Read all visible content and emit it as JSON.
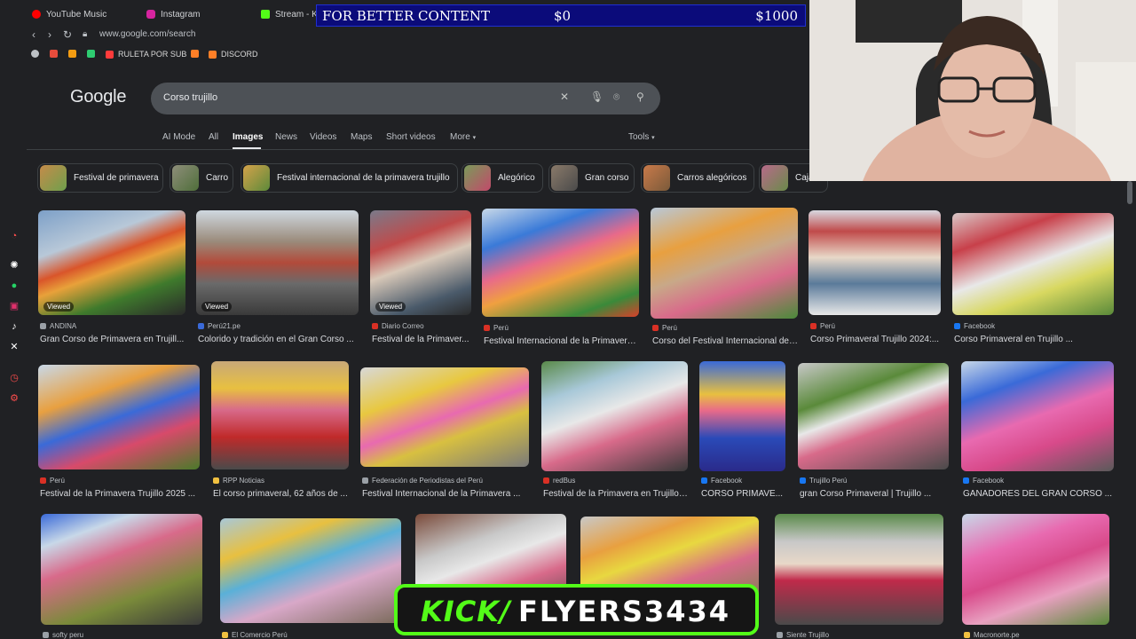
{
  "tabs": [
    {
      "label": "YouTube Music",
      "color": "#ff0000"
    },
    {
      "label": "Instagram",
      "color": "#d6249f"
    },
    {
      "label": "Stream - Kick",
      "color": "#53fc18"
    }
  ],
  "address": {
    "url": "www.google.com/search"
  },
  "bookmarks": [
    {
      "label": "",
      "color": "#bdc1c6"
    },
    {
      "label": "",
      "color": "#e74c3c"
    },
    {
      "label": "",
      "color": "#f39c12"
    },
    {
      "label": "",
      "color": "#2ecc71"
    },
    {
      "label": "RULETA POR SUB",
      "color": "#ff3b3b"
    },
    {
      "label": "",
      "color": "#ff7f27"
    },
    {
      "label": "DISCORD",
      "color": "#ff7f27"
    }
  ],
  "google": {
    "logo": "Google",
    "query": "Corso trujillo",
    "filters": [
      "AI Mode",
      "All",
      "Images",
      "News",
      "Videos",
      "Maps",
      "Short videos",
      "More"
    ],
    "active_filter": "Images",
    "tools": "Tools",
    "chips": [
      "Festival de primavera",
      "Carro",
      "Festival internacional de la primavera trujillo",
      "Alegórico",
      "Gran corso",
      "Carros alegóricos",
      "Caja..."
    ],
    "results": [
      {
        "source": "ANDINA",
        "title": "Gran Corso de Primavera en Trujill...",
        "viewed": "Viewed"
      },
      {
        "source": "Perú21.pe",
        "title": "Colorido y tradición en el Gran Corso ...",
        "viewed": "Viewed"
      },
      {
        "source": "Diario Correo",
        "title": "Festival de la Primaver...",
        "viewed": "Viewed"
      },
      {
        "source": "Perú",
        "title": "Festival Internacional de la Primavera...",
        "viewed": ""
      },
      {
        "source": "Perú",
        "title": "Corso del Festival Internacional de ...",
        "viewed": ""
      },
      {
        "source": "Perú",
        "title": "Corso Primaveral Trujillo 2024:...",
        "viewed": ""
      },
      {
        "source": "Facebook",
        "title": "Corso Primaveral en Trujillo ...",
        "viewed": ""
      },
      {
        "source": "Perú",
        "title": "Festival de la Primavera Trujillo 2025 ...",
        "viewed": ""
      },
      {
        "source": "RPP Noticias",
        "title": "El corso primaveral, 62 años de ...",
        "viewed": ""
      },
      {
        "source": "Federación de Periodistas del Perú",
        "title": "Festival Internacional de la Primavera ...",
        "viewed": ""
      },
      {
        "source": "redBus",
        "title": "Festival de la Primavera en Trujillo ...",
        "viewed": ""
      },
      {
        "source": "Facebook",
        "title": "CORSO PRIMAVE...",
        "viewed": ""
      },
      {
        "source": "Trujillo Perú",
        "title": "gran Corso Primaveral | Trujillo ...",
        "viewed": ""
      },
      {
        "source": "Facebook",
        "title": "GANADORES DEL GRAN CORSO ...",
        "viewed": ""
      },
      {
        "source": "softy peru",
        "title": "",
        "viewed": ""
      },
      {
        "source": "El Comercio Perú",
        "title": "",
        "viewed": ""
      },
      {
        "source": "",
        "title": "",
        "viewed": ""
      },
      {
        "source": "",
        "title": "",
        "viewed": ""
      },
      {
        "source": "Siente Trujillo",
        "title": "",
        "viewed": ""
      },
      {
        "source": "Macronorte.pe",
        "title": "",
        "viewed": ""
      }
    ]
  },
  "overlay": {
    "goal_text": "FOR BETTER CONTENT",
    "current": "$0",
    "target": "$1000",
    "kick_brand": "KICK/",
    "kick_handle": "FLYERS3434"
  },
  "colors": {
    "kick_green": "#53fc18",
    "goal_bg": "#0b0b7a"
  }
}
